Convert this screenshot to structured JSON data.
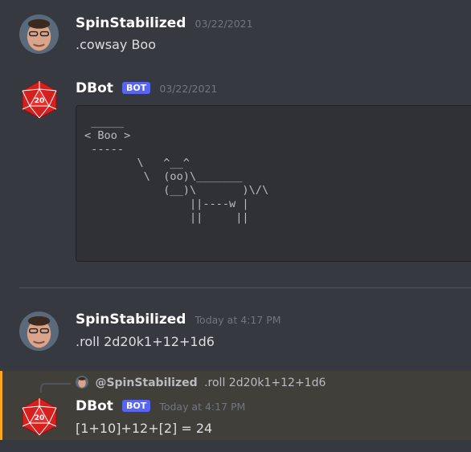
{
  "messages": [
    {
      "username": "SpinStabilized",
      "timestamp": "03/22/2021",
      "text": ".cowsay Boo",
      "avatar": "user-avatar"
    },
    {
      "username": "DBot",
      "badge": "BOT",
      "timestamp": "03/22/2021",
      "avatar": "d20-dice-icon",
      "code": " _____\n< Boo >\n -----\n        \\   ^__^\n         \\  (oo)\\_______\n            (__)\\       )\\/\\\n                ||----w |\n                ||     ||"
    },
    {
      "username": "SpinStabilized",
      "timestamp": "Today at 4:17 PM",
      "text": ".roll 2d20k1+12+1d6",
      "avatar": "user-avatar"
    },
    {
      "username": "DBot",
      "badge": "BOT",
      "timestamp": "Today at 4:17 PM",
      "avatar": "d20-dice-icon",
      "reply": {
        "mention": "@SpinStabilized",
        "text": ".roll 2d20k1+12+1d6"
      },
      "text": "[1+10]+12+[2] = 24"
    }
  ],
  "colors": {
    "background": "#36393f",
    "username": "#ffffff",
    "timestamp": "#72767d",
    "bot_badge": "#5865f2",
    "highlight": "#413f3a",
    "highlight_bar": "#faa81a",
    "dice_red": "#d4201f"
  },
  "d20_face": "20"
}
